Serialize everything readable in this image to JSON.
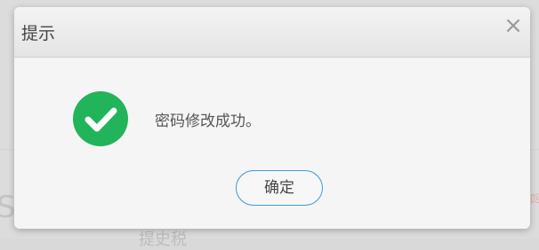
{
  "background": {
    "partial_letter": "S",
    "bottom_text": "提史税",
    "side_char": "吗"
  },
  "dialog": {
    "title": "提示",
    "close_glyph": "×",
    "icon": "success-check-icon",
    "message": "密码修改成功。",
    "confirm_label": "确定",
    "colors": {
      "success": "#22b45a",
      "button_border": "#3a9bd1"
    }
  }
}
